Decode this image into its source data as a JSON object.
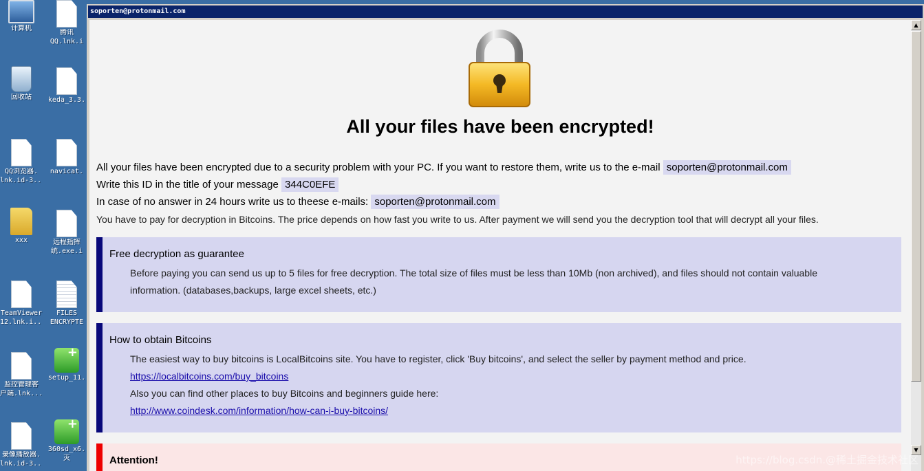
{
  "desktop": {
    "icons": [
      {
        "label1": "计算机",
        "label2": ""
      },
      {
        "label1": "腾讯",
        "label2": "QQ.lnk.i"
      },
      {
        "label1": "回收站",
        "label2": ""
      },
      {
        "label1": "keda_3.3.",
        "label2": ""
      },
      {
        "label1": "QQ浏览器.",
        "label2": "lnk.id-3..."
      },
      {
        "label1": "navicat.",
        "label2": ""
      },
      {
        "label1": "xxx",
        "label2": ""
      },
      {
        "label1": "远程指挥",
        "label2": "统.exe.i"
      },
      {
        "label1": "TeamViewer",
        "label2": "12.lnk.i..."
      },
      {
        "label1": "FILES",
        "label2": "ENCRYPTE"
      },
      {
        "label1": "监控管理客",
        "label2": "户端.lnk..."
      },
      {
        "label1": "setup_11.",
        "label2": ""
      },
      {
        "label1": "录像播放器.",
        "label2": "lnk.id-3..."
      },
      {
        "label1": "360sd_x6.",
        "label2": "灭"
      }
    ]
  },
  "window": {
    "title": "soporten@protonmail.com"
  },
  "note": {
    "headline": "All your files have been encrypted!",
    "line1_text": "All your files have been encrypted due to a security problem with your PC. If you want to restore them, write us to the e-mail",
    "line1_email": "soporten@protonmail.com",
    "line2_text": "Write this ID in the title of your message",
    "line2_id": "344C0EFE",
    "line3_text": "In case of no answer in 24 hours write us to theese e-mails:",
    "line3_email": "soporten@protonmail.com",
    "line4_text": "You have to pay for decryption in Bitcoins. The price depends on how fast you write to us. After payment we will send you the decryption tool that will decrypt all your files.",
    "box1": {
      "title": "Free decryption as guarantee",
      "p1": "Before paying you can send us up to 5 files for free decryption. The total size of files must be less than 10Mb (non archived), and files should not contain valuable",
      "p2": "information. (databases,backups, large excel sheets, etc.)"
    },
    "box2": {
      "title": "How to obtain Bitcoins",
      "p1": "The easiest way to buy bitcoins is LocalBitcoins site. You have to register, click 'Buy bitcoins', and select the seller by payment method and price.",
      "link1": "https://localbitcoins.com/buy_bitcoins",
      "p2": "Also you can find other places to buy Bitcoins and beginners guide here:",
      "link2": "http://www.coindesk.com/information/how-can-i-buy-bitcoins/"
    },
    "box3": {
      "title": "Attention!"
    }
  },
  "watermark": "https://blog.csdn.@稀土掘金技术社区",
  "colors": {
    "desktop": "#3a6ea5",
    "titlebar": "#0a246a",
    "box_bg": "#d6d6f0",
    "box_border": "#08087a",
    "attention_border": "#e00000"
  }
}
